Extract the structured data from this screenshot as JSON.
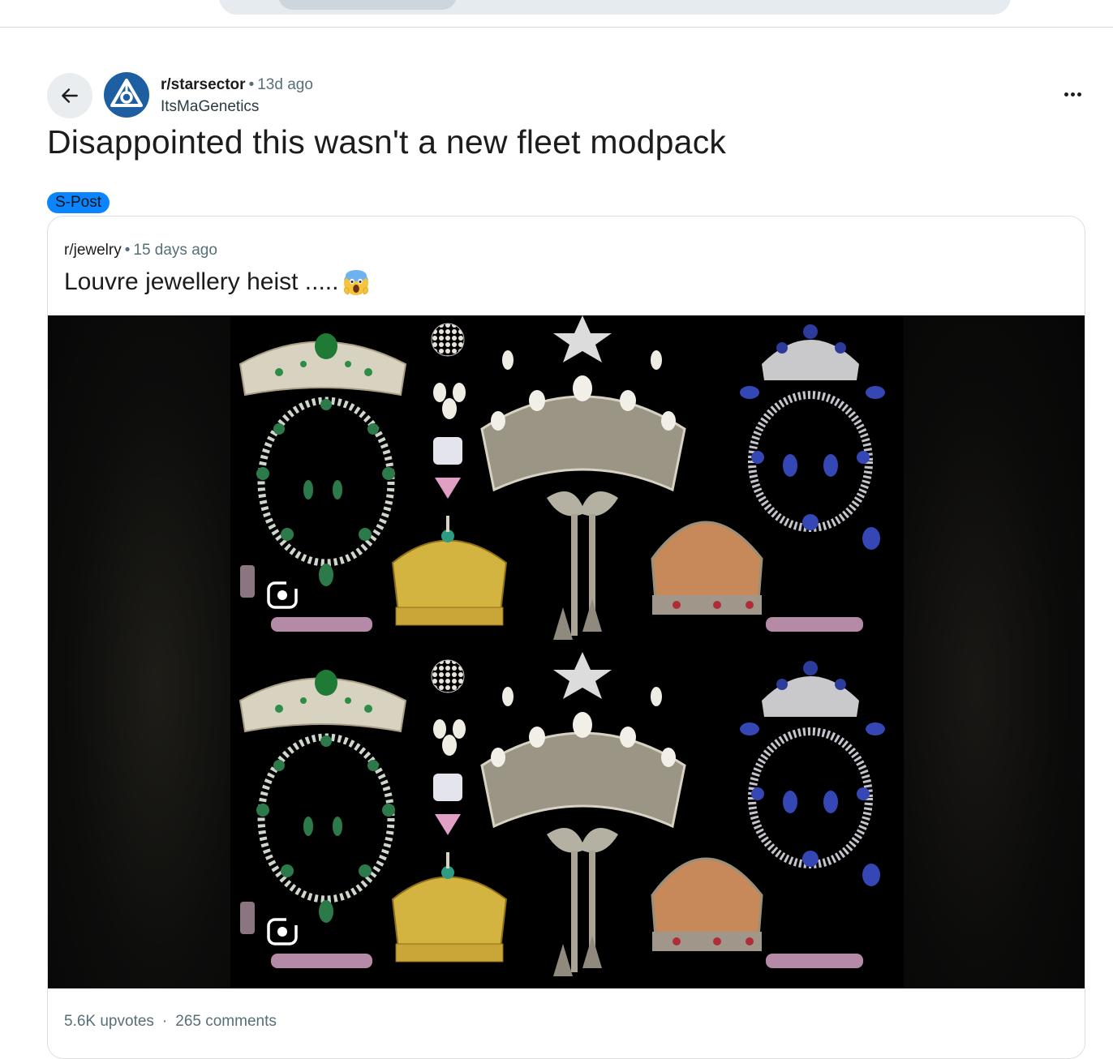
{
  "post": {
    "subreddit": "r/starsector",
    "separator": "•",
    "time": "13d ago",
    "author": "ItsMaGenetics",
    "title": "Disappointed this wasn't a new fleet modpack",
    "flair": "S-Post"
  },
  "crosspost": {
    "subreddit": "r/jewelry",
    "separator": "•",
    "time": "15 days ago",
    "title": "Louvre jewellery heist .....",
    "emoji": "face-screaming-in-fear",
    "upvotes": "5.6K upvotes",
    "stats_separator": "·",
    "comments": "265 comments"
  },
  "icons": {
    "back": "arrow-left-icon",
    "subreddit": "starsector-community-icon",
    "more": "more-options-icon",
    "lens": "google-lens-icon"
  },
  "colors": {
    "flair_bg": "#0a84ff",
    "avatar_bg": "#1d5fa0",
    "meta_text": "#576f76"
  }
}
